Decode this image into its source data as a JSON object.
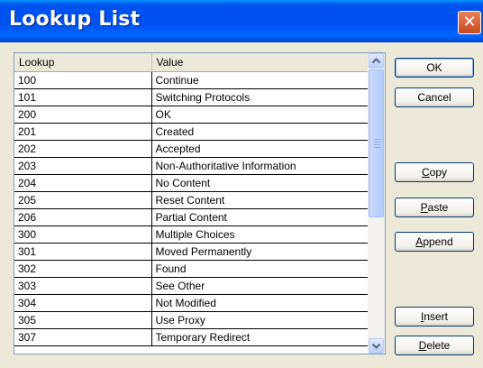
{
  "window": {
    "title": "Lookup List",
    "close_glyph": "✕"
  },
  "grid": {
    "columns": [
      "Lookup",
      "Value"
    ],
    "rows": [
      [
        "100",
        "Continue"
      ],
      [
        "101",
        "Switching Protocols"
      ],
      [
        "200",
        "OK"
      ],
      [
        "201",
        "Created"
      ],
      [
        "202",
        "Accepted"
      ],
      [
        "203",
        "Non-Authoritative Information"
      ],
      [
        "204",
        "No Content"
      ],
      [
        "205",
        "Reset Content"
      ],
      [
        "206",
        "Partial Content"
      ],
      [
        "300",
        "Multiple Choices"
      ],
      [
        "301",
        "Moved Permanently"
      ],
      [
        "302",
        "Found"
      ],
      [
        "303",
        "See Other"
      ],
      [
        "304",
        "Not Modified"
      ],
      [
        "305",
        "Use Proxy"
      ],
      [
        "307",
        "Temporary Redirect"
      ]
    ]
  },
  "buttons": {
    "ok": {
      "label": "OK"
    },
    "cancel": {
      "label": "Cancel"
    },
    "copy": {
      "mn": "C",
      "rest": "opy"
    },
    "paste": {
      "mn": "P",
      "rest": "aste"
    },
    "append": {
      "mn": "A",
      "rest": "ppend"
    },
    "insert": {
      "mn": "I",
      "rest": "nsert"
    },
    "delete": {
      "mn": "D",
      "rest": "elete"
    }
  },
  "icons": {
    "scroll_up": "chevron-up-icon",
    "scroll_down": "chevron-down-icon",
    "close": "close-icon"
  }
}
